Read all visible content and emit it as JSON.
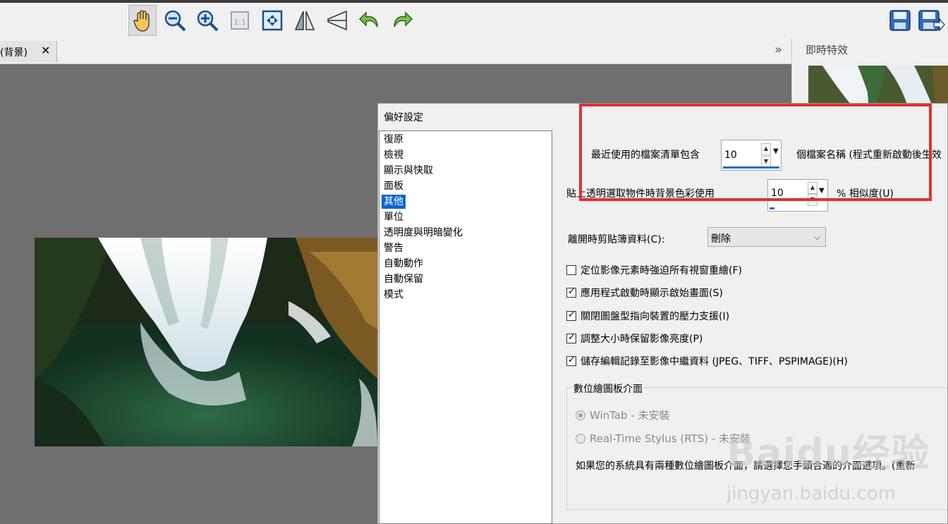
{
  "toolbar": {
    "tools": [
      "pan-hand-icon",
      "zoom-out-icon",
      "zoom-in-icon",
      "actual-size-icon",
      "fit-window-icon",
      "flip-horizontal-icon",
      "mirror-vertical-icon",
      "undo-icon",
      "redo-icon"
    ],
    "actual_size_label": "1:1",
    "right_tools": [
      "save-icon",
      "save-as-icon"
    ]
  },
  "doc_tab": {
    "label": "(背景)",
    "close_glyph": "✕"
  },
  "tab_scroll_glyph": "»",
  "right_panel": {
    "title": "即時特效"
  },
  "dialog": {
    "title": "偏好設定",
    "categories": [
      "復原",
      "檢視",
      "顯示與快取",
      "面板",
      "其他",
      "單位",
      "透明度與明暗變化",
      "警告",
      "自動動作",
      "自動保留",
      "模式"
    ],
    "selected_index": 4,
    "recent_files": {
      "label": "最近使用的檔案清單包含",
      "value": "10",
      "suffix": "個檔案名稱 (程式重新啟動後生效"
    },
    "paste_transparency": {
      "label": "貼上透明選取物件時背景色彩使用",
      "value": "10",
      "suffix": "% 相似度(U)"
    },
    "clipboard": {
      "label": "離開時剪貼簿資料(C):",
      "value": "刪除"
    },
    "checkboxes": [
      {
        "label": "定位影像元素時強迫所有視窗重繪(F)",
        "checked": false
      },
      {
        "label": "應用程式啟動時顯示啟始畫面(S)",
        "checked": true
      },
      {
        "label": "關閉圖盤型指向裝置的壓力支援(I)",
        "checked": true
      },
      {
        "label": "調整大小時保留影像亮度(P)",
        "checked": true
      },
      {
        "label": "儲存編輯記錄至影像中繼資料 (JPEG、TIFF、PSPIMAGE)(H)",
        "checked": true
      }
    ],
    "tablet_group": {
      "title": "數位繪圖板介面",
      "options": [
        "WinTab - 未安裝",
        "Real-Time Stylus (RTS) - 未安裝"
      ],
      "description": "如果您的系統具有兩種數位繪圖板介面，請選擇您手頭合適的介面選項。(重新"
    }
  },
  "watermark": {
    "brand": "Baidu经验",
    "url": "jingyan.baidu.com"
  },
  "colors": {
    "highlight": "#e03030",
    "selection": "#0a64d2",
    "dialog_bg": "#f0f0f0",
    "canvas_bg": "#6f6f6f"
  }
}
